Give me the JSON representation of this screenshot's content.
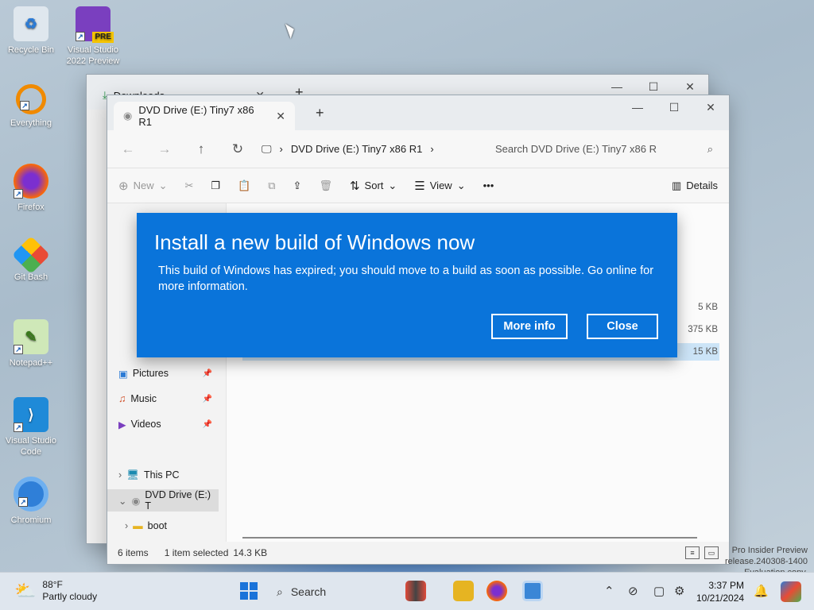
{
  "desktop": {
    "icons": [
      {
        "label": "Recycle Bin",
        "icon": "recycle-bin-icon"
      },
      {
        "label": "Visual Studio 2022 Preview",
        "badge": "PRE",
        "icon": "visual-studio-icon"
      },
      {
        "label": "Everything",
        "icon": "everything-search-icon"
      },
      {
        "label": "Firefox",
        "icon": "firefox-icon"
      },
      {
        "label": "Git Bash",
        "icon": "git-bash-icon"
      },
      {
        "label": "Notepad++",
        "icon": "notepad-plus-plus-icon"
      },
      {
        "label": "Visual Studio Code",
        "icon": "vscode-icon"
      },
      {
        "label": "Chromium",
        "icon": "chromium-icon"
      }
    ]
  },
  "back_window": {
    "tab_label": "Downloads"
  },
  "explorer": {
    "tab_label": "DVD Drive (E:) Tiny7 x86 R1",
    "breadcrumb": "DVD Drive (E:) Tiny7 x86 R1",
    "search_placeholder": "Search DVD Drive (E:) Tiny7 x86 R",
    "commands": {
      "new": "New",
      "sort": "Sort",
      "view": "View",
      "more": "•••",
      "details": "Details"
    },
    "nav_items": [
      {
        "label": "Pictures",
        "icon": "pictures-folder-icon",
        "pinned": true
      },
      {
        "label": "Music",
        "icon": "music-folder-icon",
        "pinned": true
      },
      {
        "label": "Videos",
        "icon": "videos-folder-icon",
        "pinned": true
      },
      {
        "label": "This PC",
        "icon": "this-pc-icon",
        "pinned": false
      },
      {
        "label": "DVD Drive (E:) T",
        "icon": "dvd-drive-icon",
        "pinned": false
      },
      {
        "label": "boot",
        "icon": "folder-icon",
        "pinned": false
      }
    ],
    "file_sizes": [
      "5 KB",
      "375 KB",
      "15 KB"
    ],
    "status": {
      "items": "6 items",
      "selection": "1 item selected",
      "size": "14.3 KB"
    }
  },
  "dialog": {
    "title": "Install a new build of Windows now",
    "message": "This build of Windows has expired; you should move to a build as soon as possible. Go online for more information.",
    "more_info": "More info",
    "close": "Close",
    "accent": "#0a74da"
  },
  "taskbar": {
    "weather_temp": "88°F",
    "weather_desc": "Partly cloudy",
    "search_label": "Search",
    "time": "3:37 PM",
    "date": "10/21/2024"
  },
  "watermark": {
    "line1": "Pro Insider Preview",
    "line2": "release.240308-1400",
    "line3": "Evaluation copy."
  }
}
